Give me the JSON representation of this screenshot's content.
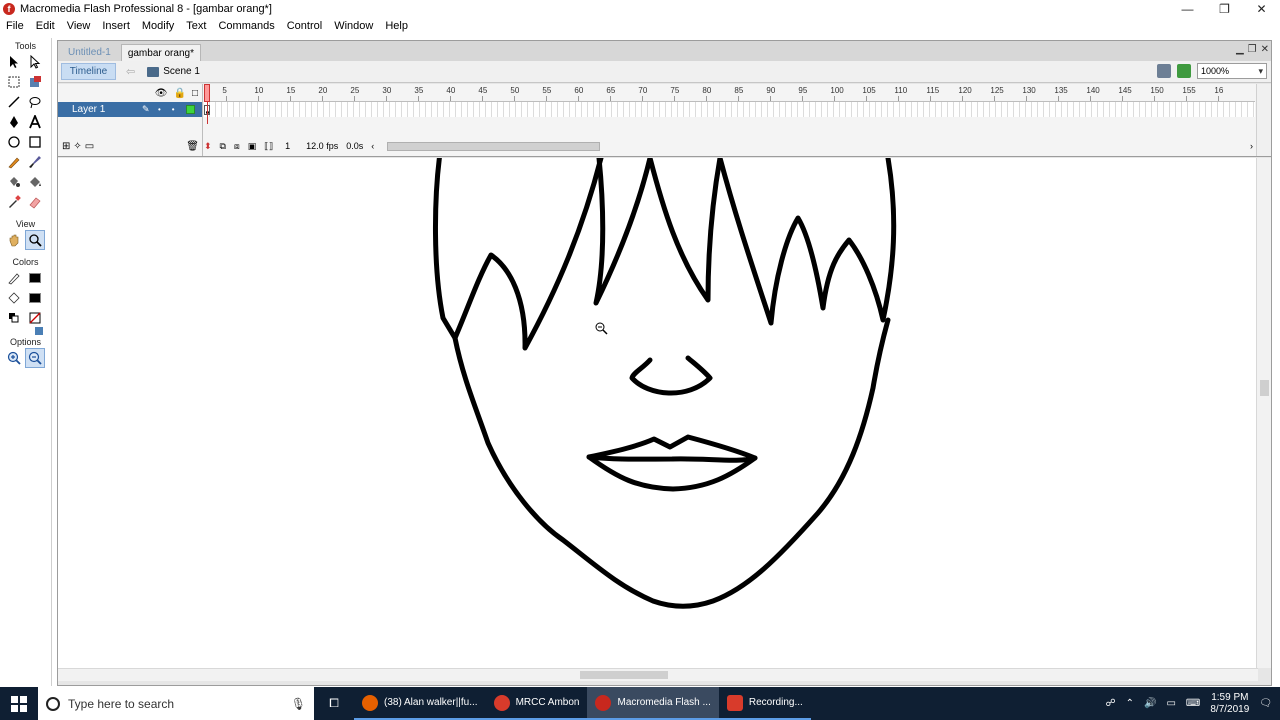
{
  "window": {
    "title": "Macromedia Flash Professional 8 - [gambar orang*]",
    "controls": [
      "—",
      "❐",
      "✕"
    ]
  },
  "menu": [
    "File",
    "Edit",
    "View",
    "Insert",
    "Modify",
    "Text",
    "Commands",
    "Control",
    "Window",
    "Help"
  ],
  "tools": {
    "title": "Tools",
    "view_title": "View",
    "colors_title": "Colors",
    "options_title": "Options"
  },
  "tabs": [
    {
      "label": "Untitled-1",
      "active": false
    },
    {
      "label": "gambar orang*",
      "active": true
    }
  ],
  "editbar": {
    "timeline_label": "Timeline",
    "scene_label": "Scene 1",
    "zoom_value": "1000%"
  },
  "timeline": {
    "layer_name": "Layer 1",
    "ruler": [
      "5",
      "10",
      "15",
      "20",
      "25",
      "30",
      "35",
      "40",
      "45",
      "50",
      "55",
      "60",
      "65",
      "70",
      "75",
      "80",
      "85",
      "90",
      "95",
      "100",
      "105",
      "110",
      "115",
      "120",
      "125",
      "130",
      "135",
      "140",
      "145",
      "150",
      "155",
      "16"
    ],
    "current_frame": "1",
    "fps": "12.0 fps",
    "elapsed": "0.0s"
  },
  "taskbar": {
    "search_placeholder": "Type here to search",
    "items": [
      {
        "label": "(38) Alan walker||fu...",
        "color": "#e66000"
      },
      {
        "label": "MRCC Ambon",
        "color": "#d83b2b"
      },
      {
        "label": "Macromedia Flash ...",
        "color": "#c8281e",
        "active": true
      },
      {
        "label": "Recording...",
        "color": "#d83b2b"
      }
    ],
    "time": "1:59 PM",
    "date": "8/7/2019"
  },
  "colors": {
    "accent": "#3a6ea5",
    "taskbar_bg": "#0f1f33"
  }
}
